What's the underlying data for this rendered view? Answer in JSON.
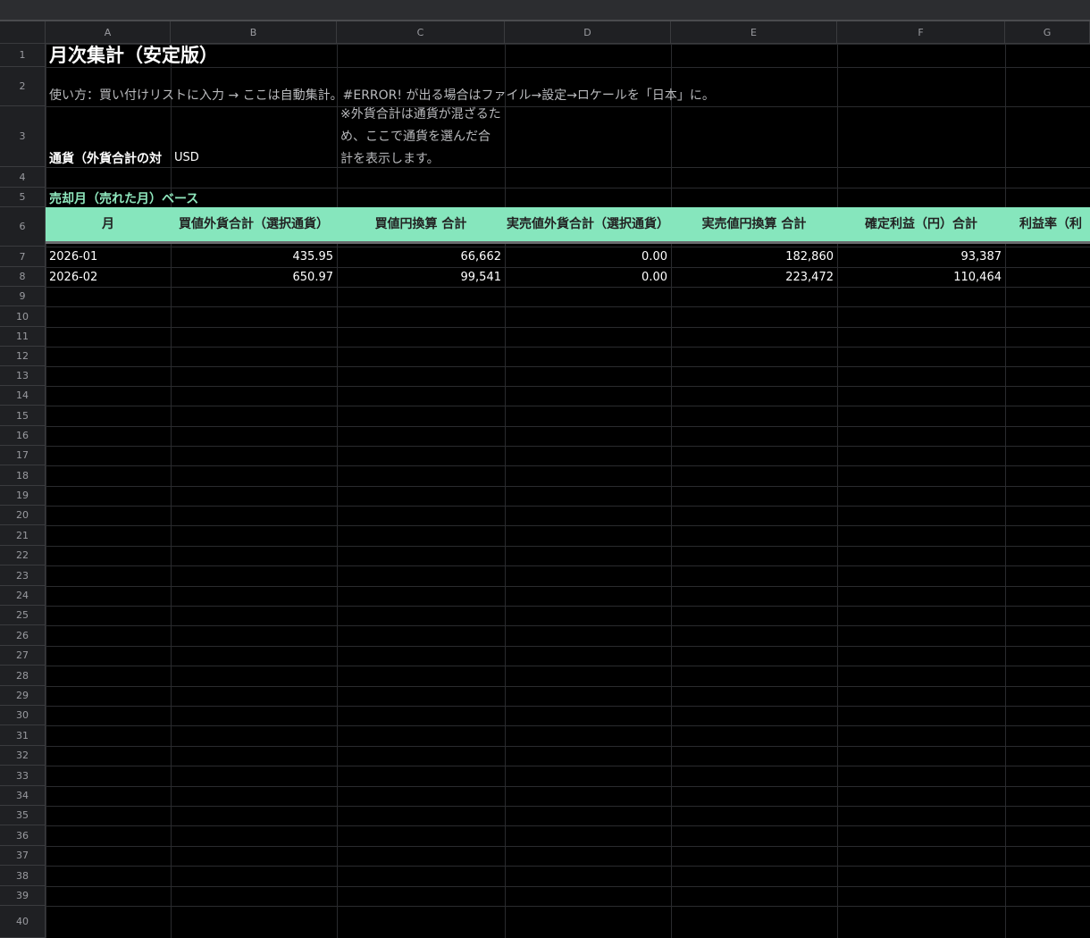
{
  "sheet": {
    "columns": [
      "A",
      "B",
      "C",
      "D",
      "E",
      "F",
      "G"
    ],
    "rows": [
      "1",
      "2",
      "3",
      "4",
      "5",
      "6",
      "7",
      "8",
      "9",
      "10",
      "11",
      "12",
      "13",
      "14",
      "15",
      "16",
      "17",
      "18",
      "19",
      "20",
      "21",
      "22",
      "23",
      "24",
      "25",
      "26",
      "27",
      "28",
      "29",
      "30",
      "31",
      "32",
      "33",
      "34",
      "35",
      "36",
      "37",
      "38",
      "39",
      "40"
    ],
    "title": "月次集計（安定版）",
    "howto": "使い方：買い付けリストに入力 → ここは自動集計。#ERROR! が出る場合はファイル→設定→ロケールを「日本」に。",
    "currency_label": "通貨（外貨合計の対",
    "currency_value": "USD",
    "note": "※外貨合計は通貨が混ざるため、ここで通貨を選んだ合計を表示します。",
    "section": "売却月（売れた月）ベース",
    "headers": [
      "月",
      "買値外貨合計（選択通貨）",
      "買値円換算 合計",
      "実売値外貨合計（選択通貨）",
      "実売値円換算 合計",
      "確定利益（円）合計",
      "利益率（利"
    ],
    "data_rows": [
      [
        "2026-01",
        "435.95",
        "66,662",
        "0.00",
        "182,860",
        "93,387"
      ],
      [
        "2026-02",
        "650.97",
        "99,541",
        "0.00",
        "223,472",
        "110,464"
      ]
    ]
  },
  "colors": {
    "header_fill": "#86e6bd",
    "section_text": "#8fe7bd",
    "background": "#000000"
  }
}
